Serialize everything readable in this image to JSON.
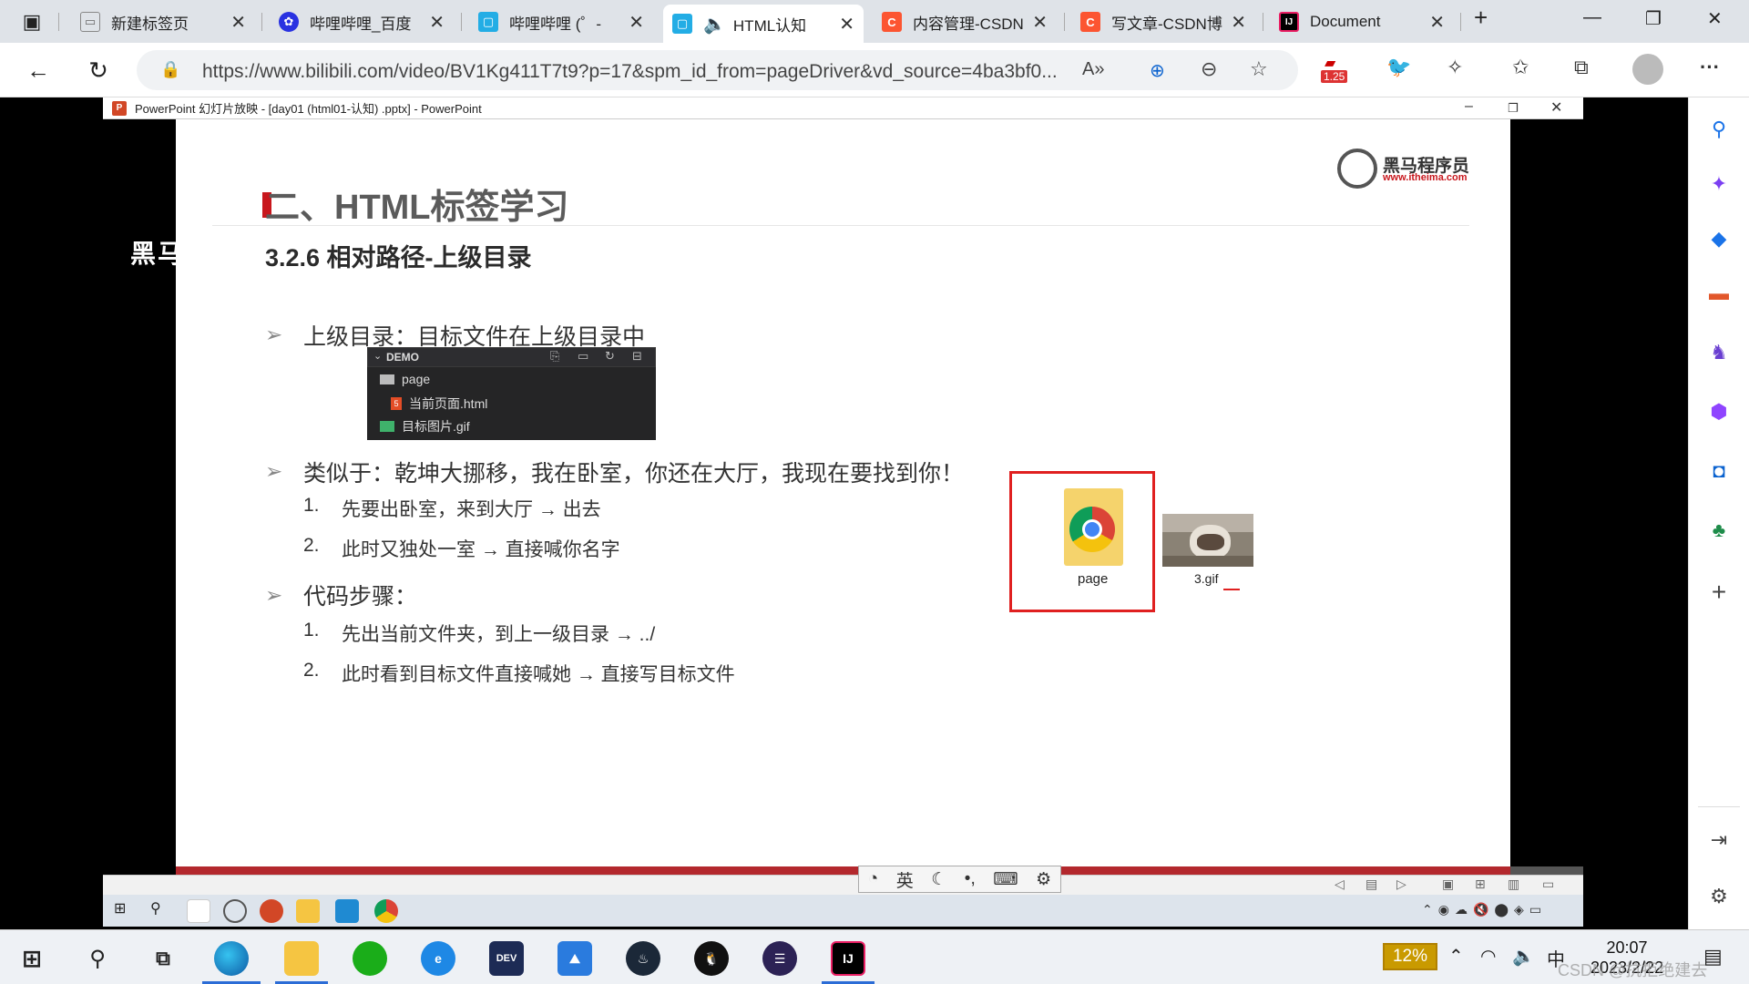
{
  "browser": {
    "tabs": [
      {
        "label": "新建标签页",
        "icon": "new-tab-icon"
      },
      {
        "label": "哔哩哔哩_百度",
        "icon": "baidu-icon"
      },
      {
        "label": "哔哩哔哩 (゜-",
        "icon": "bilibili-icon"
      },
      {
        "label": "HTML认知",
        "icon": "bilibili-icon",
        "active": true
      },
      {
        "label": "内容管理-CSDN",
        "icon": "csdn-icon"
      },
      {
        "label": "写文章-CSDN博",
        "icon": "csdn-icon"
      },
      {
        "label": "Document",
        "icon": "intellij-icon"
      }
    ],
    "url": "https://www.bilibili.com/video/BV1Kg411T7t9?p=17&spm_id_from=pageDriver&vd_source=4ba3bf0...",
    "badge": "1.25",
    "colors": {
      "bilibili": "#23ade5",
      "csdn": "#fc5531",
      "accent": "#0a62cf"
    }
  },
  "ppt": {
    "window_title": "PowerPoint 幻灯片放映 - [day01 (html01-认知) .pptx] - PowerPoint",
    "watermark": "黑马程序员",
    "slide": {
      "title": "二、HTML标签学习",
      "brand_name": "黑马程序员",
      "brand_url": "www.itheima.com",
      "subtitle": "3.2.6 相对路径-上级目录",
      "bullets": [
        {
          "marker": "➢",
          "text": "上级目录：目标文件在上级目录中"
        },
        {
          "marker": "➢",
          "text": "类似于：乾坤大挪移，我在卧室，你还在大厅，我现在要找到你！"
        },
        {
          "marker": "➢",
          "text": "代码步骤："
        }
      ],
      "steps_a": [
        {
          "n": "1.",
          "text": "先要出卧室，来到大厅 → 出去"
        },
        {
          "n": "2.",
          "text": "此时又独处一室 → 直接喊你名字"
        }
      ],
      "steps_b": [
        {
          "n": "1.",
          "text": "先出当前文件夹，到上一级目录 → ../"
        },
        {
          "n": "2.",
          "text": "此时看到目标文件直接喊她 → 直接写目标文件"
        }
      ],
      "explorer": {
        "header": "DEMO",
        "items": [
          "page",
          "当前页面.html",
          "目标图片.gif"
        ]
      },
      "folder_label": "page",
      "image_label": "3.gif"
    },
    "ime": {
      "lang": "英"
    }
  },
  "taskbar": {
    "battery": "12%",
    "ime_lang": "中",
    "time": "20:07",
    "date": "2023/2/22",
    "watermark": "CSDN @抗拒绝建去"
  }
}
